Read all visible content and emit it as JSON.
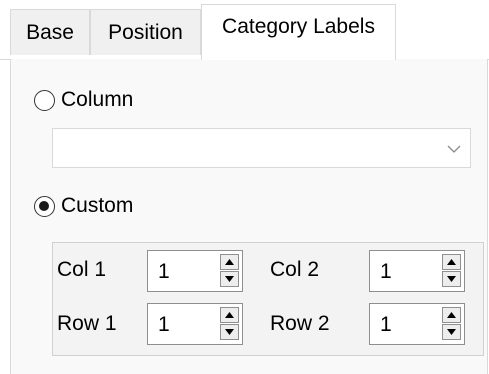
{
  "tabs": [
    {
      "label": "Base",
      "active": false
    },
    {
      "label": "Position",
      "active": false
    },
    {
      "label": "Category Labels",
      "active": true
    }
  ],
  "category_labels": {
    "column_option": {
      "label": "Column",
      "selected": false
    },
    "column_combo": {
      "value": ""
    },
    "custom_option": {
      "label": "Custom",
      "selected": true
    },
    "custom_fields": {
      "col1": {
        "label": "Col 1",
        "value": "1"
      },
      "col2": {
        "label": "Col 2",
        "value": "1"
      },
      "row1": {
        "label": "Row 1",
        "value": "1"
      },
      "row2": {
        "label": "Row 2",
        "value": "1"
      }
    }
  },
  "icons": {
    "combo_dropdown": "chevron-down-icon",
    "spin_up": "triangle-up-icon",
    "spin_down": "triangle-down-icon"
  },
  "colors": {
    "border": "#d9d9d9",
    "panel_background": "#f9f9f9",
    "inactive_tab": "#f0f0f0"
  }
}
